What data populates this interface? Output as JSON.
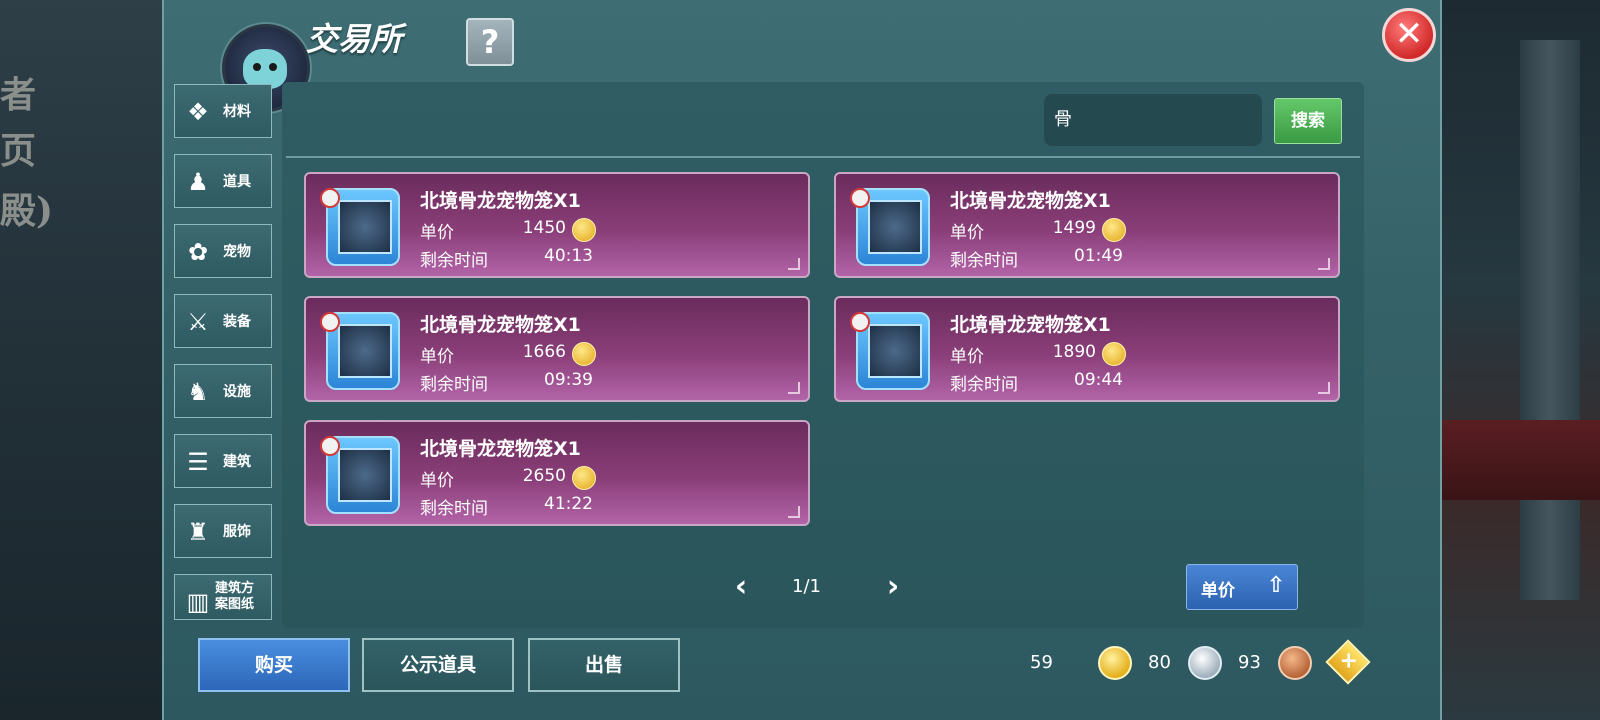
{
  "background": {
    "left_text": [
      "者",
      "页",
      "殿)"
    ]
  },
  "header": {
    "title": "交易所",
    "help_label": "?",
    "close_label": "✕"
  },
  "sidebar": {
    "items": [
      {
        "label": "材料",
        "icon": "materials-icon",
        "glyph": "❖"
      },
      {
        "label": "道具",
        "icon": "item-icon",
        "glyph": "♟"
      },
      {
        "label": "宠物",
        "icon": "paw-icon",
        "glyph": "✿"
      },
      {
        "label": "装备",
        "icon": "equipment-icon",
        "glyph": "⚔"
      },
      {
        "label": "设施",
        "icon": "facility-icon",
        "glyph": "♞"
      },
      {
        "label": "建筑",
        "icon": "building-icon",
        "glyph": "☰"
      },
      {
        "label": "服饰",
        "icon": "clothing-icon",
        "glyph": "♜"
      },
      {
        "label": "建筑方\n案图纸",
        "icon": "blueprint-icon",
        "glyph": "▥"
      }
    ]
  },
  "search": {
    "value": "骨",
    "button_label": "搜索"
  },
  "listings": [
    {
      "name": "北境骨龙宠物笼X1",
      "price_label": "单价",
      "price": "1450",
      "time_label": "剩余时间",
      "time": "40:13"
    },
    {
      "name": "北境骨龙宠物笼X1",
      "price_label": "单价",
      "price": "1499",
      "time_label": "剩余时间",
      "time": "01:49"
    },
    {
      "name": "北境骨龙宠物笼X1",
      "price_label": "单价",
      "price": "1666",
      "time_label": "剩余时间",
      "time": "09:39"
    },
    {
      "name": "北境骨龙宠物笼X1",
      "price_label": "单价",
      "price": "1890",
      "time_label": "剩余时间",
      "time": "09:44"
    },
    {
      "name": "北境骨龙宠物笼X1",
      "price_label": "单价",
      "price": "2650",
      "time_label": "剩余时间",
      "time": "41:22"
    }
  ],
  "pager": {
    "prev": "‹",
    "next": "›",
    "page": "1/1"
  },
  "sort": {
    "label": "单价",
    "arrow": "⇧"
  },
  "bottom": {
    "buy_label": "购买",
    "public_label": "公示道具",
    "sell_label": "出售",
    "gold": "59",
    "silver": "80",
    "bronze": "93",
    "plus": "+"
  },
  "colors": {
    "listing": "#8a3e78",
    "active_tab": "#4a8ee0",
    "search_button": "#3b9a44",
    "close": "#d22a2a"
  }
}
